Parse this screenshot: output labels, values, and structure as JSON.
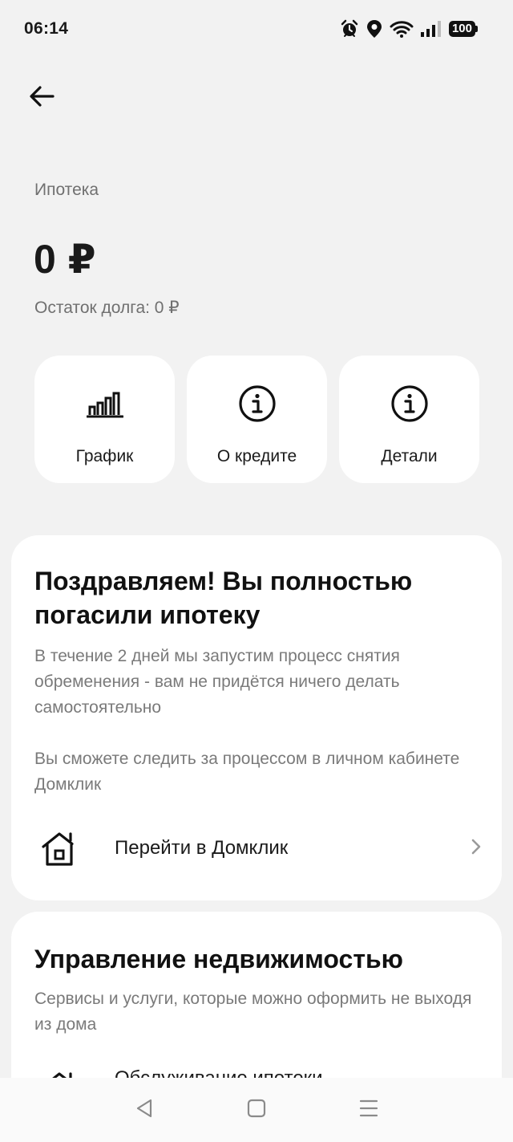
{
  "status_bar": {
    "time": "06:14",
    "battery": "100",
    "icons": [
      "alarm-icon",
      "location-icon",
      "wifi-icon",
      "signal-icon",
      "battery-icon"
    ]
  },
  "header": {
    "back_icon": "arrow-left-icon"
  },
  "summary": {
    "product_label": "Ипотека",
    "balance": "0 ₽",
    "debt_left": "Остаток долга: 0 ₽"
  },
  "actions": [
    {
      "label": "График",
      "icon": "chart-icon"
    },
    {
      "label": "О кредите",
      "icon": "info-icon"
    },
    {
      "label": "Детали",
      "icon": "info-icon"
    }
  ],
  "congrats_card": {
    "title": "Поздравляем! Вы полностью погасили ипотеку",
    "text1": "В течение 2 дней мы запустим процесс снятия обременения - вам не придётся ничего делать самостоятельно",
    "text2": "Вы сможете следить за процессом в личном кабинете Домклик",
    "link_label": "Перейти в Домклик",
    "link_icon": "house-icon"
  },
  "manage_card": {
    "title": "Управление недвижимостью",
    "text": "Сервисы и услуги, которые можно оформить не выходя из дома",
    "link_label": "Обслуживание ипотеки",
    "link_icon": "house-icon"
  },
  "nav_bar": {
    "buttons": [
      "back-triangle-icon",
      "home-square-icon",
      "menu-lines-icon"
    ]
  },
  "colors": {
    "background": "#f2f2f2",
    "card": "#ffffff",
    "text_primary": "#1a1a1a",
    "text_secondary": "#7a7a7a"
  }
}
